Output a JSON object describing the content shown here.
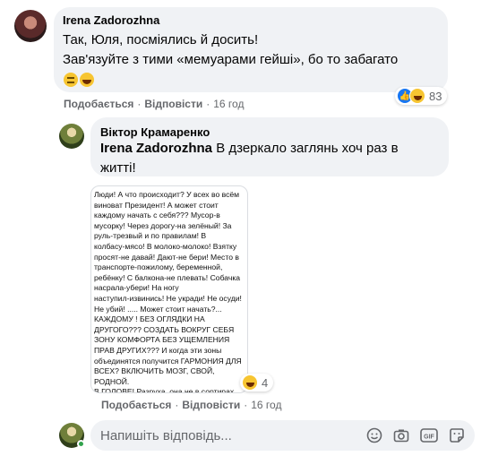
{
  "comment1": {
    "author": "Irena Zadorozhna",
    "line1": "Так, Юля, посміялись й досить!",
    "line2": "Зав'язуйте з тими «мемуарами гейші», бо то забагато",
    "emojis": [
      "expressionless-face",
      "rolling-laughing-face"
    ],
    "reactions": {
      "icons": [
        "like",
        "haha"
      ],
      "count": "83"
    },
    "actions": {
      "like": "Подобається",
      "reply": "Відповісти",
      "time": "16 год"
    }
  },
  "comment2": {
    "author": "Віктор Крамаренко",
    "mention": "Irena Zadorozhna",
    "text_after_mention": " В дзеркало заглянь хоч раз в",
    "line2": "житті!",
    "attachment_text": "Люди! А что происходит? У всех во всём\nвиноват Президент! А может стоит\nкаждому начать с себя??? Мусор-в\nмусорку! Через дорогу-на зелёный! За\nруль-трезвый и по правилам! В\nколбасу-мясо! В молоко-молоко! Взятку\nпросят-не давай! Дают-не бери! Место в\nтранспорте-пожилому, беременной,\nребёнку! С балкона-не плевать! Собачка\nнасрала-убери! На ногу\nнаступил-извинись! Не укради! Не осуди!\nНе убий! ..... Может стоит начать?...\nКАЖДОМУ ! БЕЗ ОГЛЯДКИ НА\nДРУГОГО??? СОЗДАТЬ ВОКРУГ СЕБЯ\nЗОНУ КОМФОРТА БЕЗ УЩЕМЛЕНИЯ\nПРАВ ДРУГИХ??? И когда эти зоны\nобъединятся получится ГАРМОНИЯ ДЛЯ\nВСЕХ? ВКЛЮЧИТЬ МОЗГ, СВОЙ, РОДНОЙ.\nВ ГОЛОВЕ! Разруха, она не в сортирах,\nона в головах!",
    "reactions": {
      "icons": [
        "haha"
      ],
      "count": "4"
    },
    "actions": {
      "like": "Подобається",
      "reply": "Відповісти",
      "time": "16 год"
    }
  },
  "reply_box": {
    "placeholder": "Напишіть відповідь...",
    "tools": [
      "emoji-icon",
      "camera-icon",
      "gif-icon",
      "sticker-icon"
    ]
  },
  "colors": {
    "bubble": "#f0f2f5",
    "secondary_text": "#65676b",
    "like_blue": "#1877f2",
    "online_green": "#31a24c"
  }
}
